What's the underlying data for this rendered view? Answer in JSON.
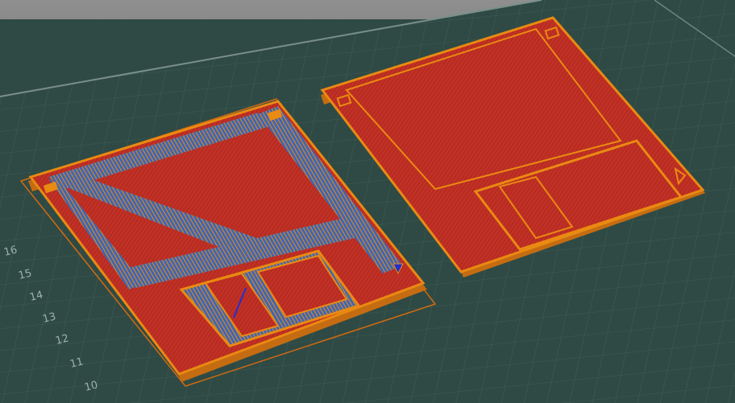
{
  "viewport": {
    "background": "#2f4a44",
    "grid_color": "#3f5c55",
    "grid_major_color": "#4f6f66",
    "bed_edge_color": "#8c8c8c",
    "colors": {
      "perimeter": "#e98a12",
      "infill": "#c33025",
      "support_infill": "#3f66b4",
      "travel": "#2030d0",
      "skirt": "#d26a10"
    }
  },
  "axis": {
    "labels": [
      "16",
      "15",
      "14",
      "13",
      "12",
      "11",
      "10"
    ]
  },
  "objects": [
    {
      "name": "floppy-disk-left",
      "layer_view": "mixed-infill"
    },
    {
      "name": "floppy-disk-right",
      "layer_view": "solid-infill"
    }
  ]
}
